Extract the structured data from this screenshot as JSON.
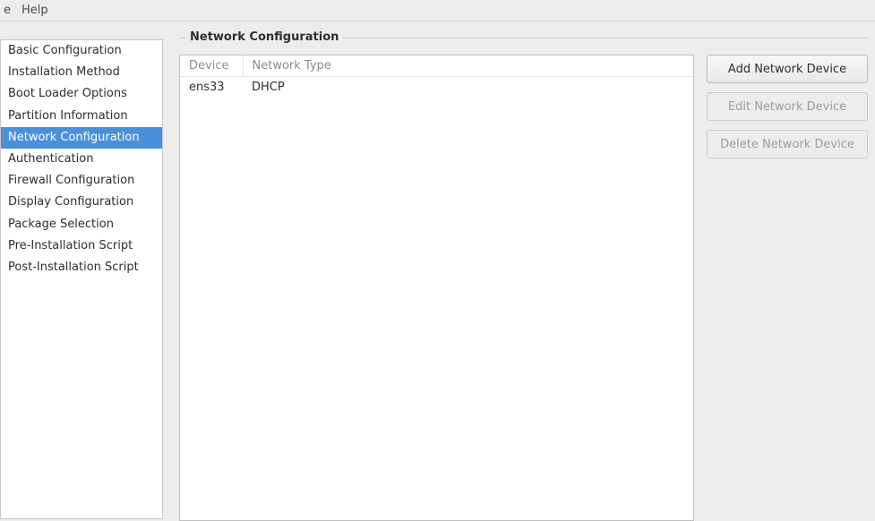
{
  "menubar": {
    "items": [
      "e",
      "Help"
    ]
  },
  "sidebar": {
    "items": [
      {
        "label": "Basic Configuration",
        "selected": false
      },
      {
        "label": "Installation Method",
        "selected": false
      },
      {
        "label": "Boot Loader Options",
        "selected": false
      },
      {
        "label": "Partition Information",
        "selected": false
      },
      {
        "label": "Network Configuration",
        "selected": true
      },
      {
        "label": "Authentication",
        "selected": false
      },
      {
        "label": "Firewall Configuration",
        "selected": false
      },
      {
        "label": "Display Configuration",
        "selected": false
      },
      {
        "label": "Package Selection",
        "selected": false
      },
      {
        "label": "Pre-Installation Script",
        "selected": false
      },
      {
        "label": "Post-Installation Script",
        "selected": false
      }
    ]
  },
  "panel": {
    "title": "Network Configuration",
    "table": {
      "columns": [
        "Device",
        "Network Type"
      ],
      "rows": [
        {
          "device": "ens33",
          "network_type": "DHCP"
        }
      ]
    },
    "buttons": {
      "add": "Add Network Device",
      "edit": "Edit Network Device",
      "delete": "Delete Network Device",
      "edit_enabled": false,
      "delete_enabled": false
    }
  }
}
